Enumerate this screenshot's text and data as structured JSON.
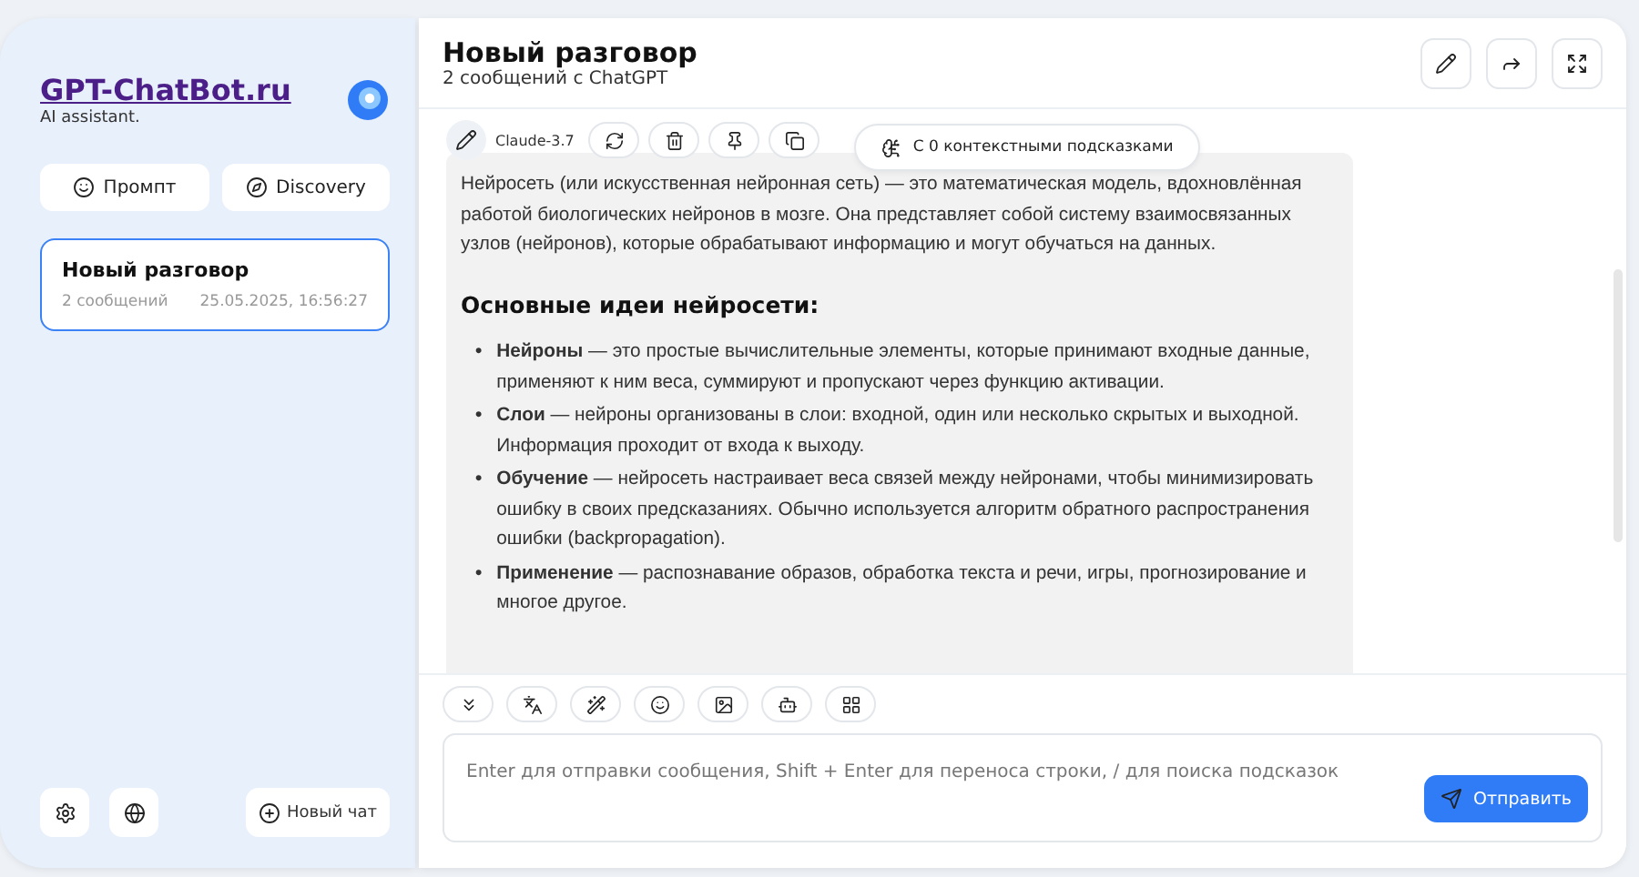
{
  "sidebar": {
    "brand": "GPT-ChatBot.ru",
    "tagline": "AI assistant.",
    "buttons": [
      {
        "kind": "prompt",
        "label": "Промпт"
      },
      {
        "kind": "discovery",
        "label": "Discovery"
      }
    ],
    "chats": [
      {
        "title": "Новый разговор",
        "count": "2 сообщений",
        "date": "25.05.2025, 16:56:27",
        "selected": true
      }
    ],
    "footer": {
      "new_chat": "Новый чат"
    }
  },
  "header": {
    "title": "Новый разговор",
    "subtitle": "2 сообщений с ChatGPT"
  },
  "message": {
    "model": "Claude-3.7",
    "hints": "С 0 контекстными подсказками",
    "intro": "Нейросеть (или искусственная нейронная сеть) — это математическая модель, вдохновлённая работой биологических нейронов в мозге. Она представляет собой систему взаимосвязанных узлов (нейронов), которые обрабатывают информацию и могут обучаться на данных.",
    "heading": "Основные идеи нейросети:",
    "bullets": [
      "**Нейроны** — это простые вычислительные элементы, которые принимают входные данные, применяют к ним веса, суммируют и пропускают через функцию активации.",
      "**Слои** — нейроны организованы в слои: входной, один или несколько скрытых и выходной. Информация проходит от входа к выходу.",
      "**Обучение** — нейросеть настраивает веса связей между нейронами, чтобы минимизировать ошибку в своих предсказаниях. Обычно используется алгоритм обратного распространения ошибки (backpropagation).",
      "**Применение** — распознавание образов, обработка текста и речи, игры, прогнозирование и многое другое."
    ],
    "marker": "•"
  },
  "composer": {
    "placeholder": "Enter для отправки сообщения, Shift + Enter для переноса строки, / для поиска подсказок",
    "send": "Отправить"
  }
}
